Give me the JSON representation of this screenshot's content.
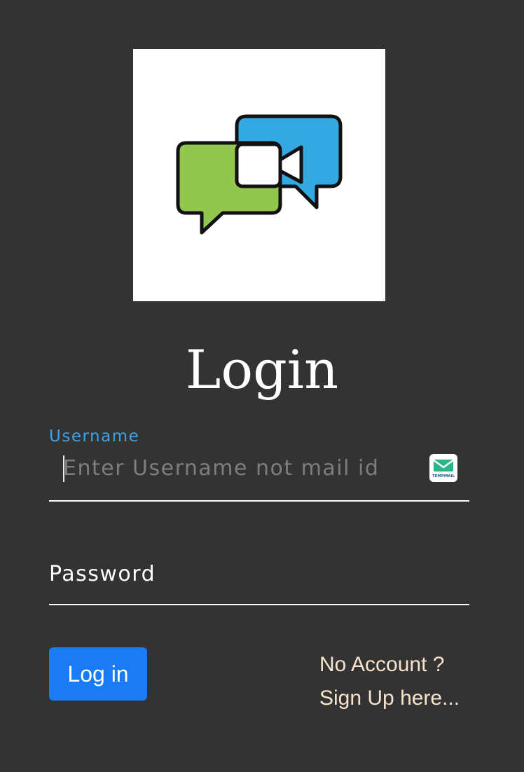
{
  "logo": {
    "icon": "video-chat-bubbles-icon",
    "colors": {
      "green": "#93c64c",
      "blue": "#34a8e0",
      "outline": "#111111",
      "background": "#ffffff"
    }
  },
  "page_title": "Login",
  "username": {
    "label": "Username",
    "placeholder": "Enter Username not mail id",
    "value": "",
    "extension_icon": "tempmail-icon",
    "extension_text": "TEMPMAIL"
  },
  "password": {
    "label": "Password",
    "value": ""
  },
  "login_button": {
    "label": "Log in"
  },
  "signup": {
    "line1": "No Account ?",
    "line2": "Sign Up here..."
  },
  "colors": {
    "background": "#333333",
    "accent": "#1a7cf5",
    "label_focus": "#3ea3e6",
    "link": "#f8e3cc"
  }
}
